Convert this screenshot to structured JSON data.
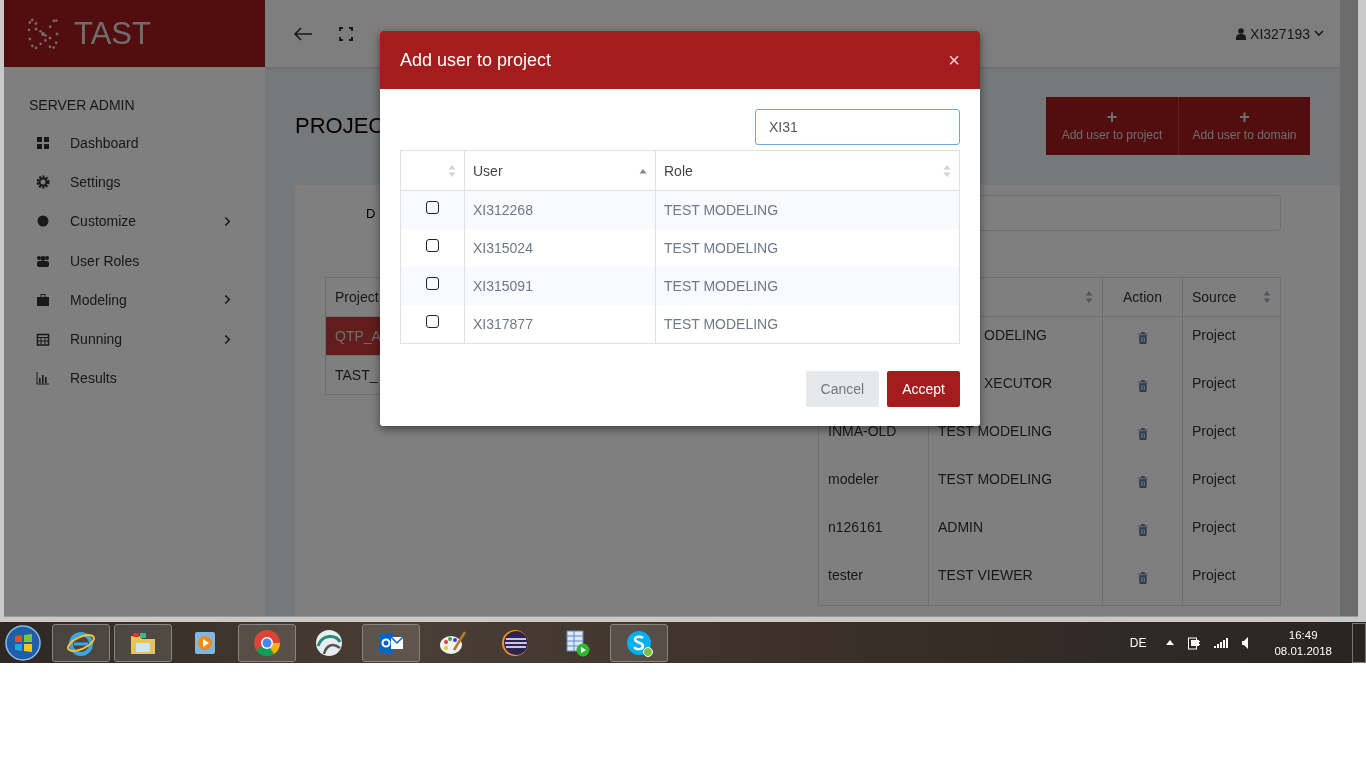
{
  "app": {
    "logo": "TAST",
    "user": "XI327193"
  },
  "sidebar": {
    "heading": "SERVER ADMIN",
    "items": [
      {
        "label": "Dashboard",
        "expandable": false
      },
      {
        "label": "Settings",
        "expandable": false
      },
      {
        "label": "Customize",
        "expandable": true
      },
      {
        "label": "User Roles",
        "expandable": false
      },
      {
        "label": "Modeling",
        "expandable": true
      },
      {
        "label": "Running",
        "expandable": true
      },
      {
        "label": "Results",
        "expandable": false
      }
    ]
  },
  "page": {
    "title": "PROJEC",
    "add_buttons": [
      {
        "icon": "+",
        "label": "Add user to project"
      },
      {
        "icon": "+",
        "label": "Add user to domain"
      }
    ],
    "filter_label": "D",
    "projects": {
      "header": "Project",
      "rows": [
        {
          "name": "QTP_A",
          "selected": true
        },
        {
          "name": "TAST_",
          "selected": false
        }
      ]
    },
    "members": {
      "columns": [
        {
          "sortable": true
        },
        {
          "label": "Action",
          "sortable": false
        },
        {
          "label": "Source",
          "sortable": true
        }
      ],
      "rows": [
        {
          "role": "ODELING",
          "source": "Project"
        },
        {
          "role": "XECUTOR",
          "source": "Project"
        },
        {
          "user": "INMA-OLD",
          "role": "TEST MODELING",
          "source": "Project"
        },
        {
          "user": "modeler",
          "role": "TEST MODELING",
          "source": "Project"
        },
        {
          "user": "n126161",
          "role": "ADMIN",
          "source": "Project"
        },
        {
          "user": "tester",
          "role": "TEST VIEWER",
          "source": "Project"
        }
      ]
    }
  },
  "dialog": {
    "title": "Add user to project",
    "close": "×",
    "search": "XI31",
    "columns": [
      {
        "sortable": true,
        "sorted_ascending": false
      },
      {
        "label": "User",
        "sortable": true,
        "sorted_ascending": true
      },
      {
        "label": "Role",
        "sortable": true,
        "sorted_ascending": false
      }
    ],
    "rows": [
      {
        "checked": false,
        "user": "XI312268",
        "role": "TEST MODELING"
      },
      {
        "checked": false,
        "user": "XI315024",
        "role": "TEST MODELING"
      },
      {
        "checked": false,
        "user": "XI315091",
        "role": "TEST MODELING"
      },
      {
        "checked": false,
        "user": "XI317877",
        "role": "TEST MODELING"
      }
    ],
    "buttons": [
      {
        "kind": "secondary",
        "label": "Cancel"
      },
      {
        "kind": "primary",
        "label": "Accept"
      }
    ]
  },
  "taskbar": {
    "items": [
      {
        "open": true
      },
      {
        "open": true
      },
      {
        "open": false
      },
      {
        "open": true
      },
      {
        "open": false
      },
      {
        "open": true
      },
      {
        "open": false
      },
      {
        "open": false
      },
      {
        "open": false
      },
      {
        "open": true
      }
    ],
    "language": "DE",
    "time": "16:49",
    "date": "08.01.2018"
  }
}
